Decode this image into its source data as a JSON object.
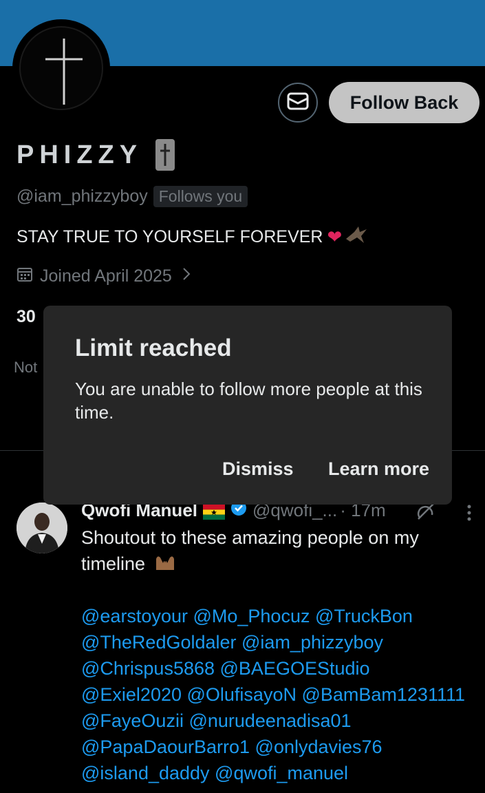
{
  "profile": {
    "display_name": "PHIZZY",
    "handle": "@iam_phizzyboy",
    "follows_you": "Follows you",
    "bio": "STAY TRUE TO YOURSELF FOREVER",
    "joined": "Joined April 2025",
    "count_partial": "30",
    "notice_partial": "Not",
    "follow_button": "Follow Back",
    "banner_color": "#1a6fa8"
  },
  "dialog": {
    "title": "Limit reached",
    "body": "You are unable to follow more people at this time.",
    "dismiss": "Dismiss",
    "learn_more": "Learn more"
  },
  "tweet": {
    "author": "Qwofi Manuel",
    "handle": "@qwofi_...",
    "time": "· 17m",
    "text": "Shoutout to these amazing people on my timeline",
    "mention_lines": [
      "@earstoyour @Mo_Phocuz @TruckBon",
      "@TheRedGoldaler @iam_phizzyboy",
      "@Chrispus5868 @BAEGOEStudio",
      "@Exiel2020 @OlufisayoN @BamBam1231111",
      "@FayeOuzii @nurudeenadisa01",
      "@PapaDaourBarro1 @onlydavies76",
      "@island_daddy @qwofi_manuel"
    ],
    "link_color": "#1d9bf0"
  },
  "icons": {
    "avatar": "cross-icon",
    "message": "envelope-icon",
    "calendar": "calendar-icon",
    "chevron": "chevron-right-icon",
    "verified": "verified-badge-icon",
    "flag": "ghana-flag-icon",
    "grok": "grok-icon",
    "more": "more-vertical-icon"
  }
}
